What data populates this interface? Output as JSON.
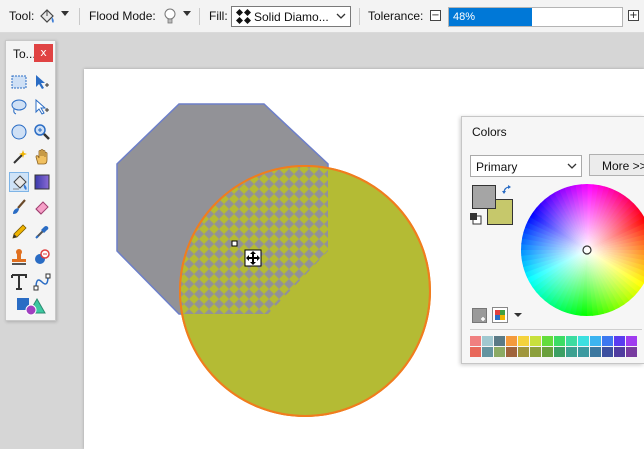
{
  "toolbar": {
    "tool_label": "Tool:",
    "flood_mode_label": "Flood Mode:",
    "fill_label": "Fill:",
    "fill_value": "Solid Diamo...",
    "tolerance_label": "Tolerance:",
    "tolerance_value": "48%",
    "tolerance_fraction": 0.48,
    "decrease_symbol": "−",
    "increase_symbol": "+"
  },
  "tools_panel": {
    "title": "To...",
    "close": "x",
    "tools": [
      "rectangle-select-icon",
      "move-selection-icon",
      "lasso-select-icon",
      "move-selected-icon",
      "ellipse-select-icon",
      "zoom-icon",
      "magic-wand-icon",
      "pan-icon",
      "paint-bucket-icon",
      "gradient-icon",
      "paintbrush-icon",
      "eraser-icon",
      "pencil-icon",
      "color-picker-icon",
      "clone-stamp-icon",
      "recolor-icon",
      "text-icon",
      "line-curve-icon",
      "shapes-icon"
    ],
    "active_tool": "paint-bucket-icon"
  },
  "colors_panel": {
    "title": "Colors",
    "mode": "Primary",
    "more_button": "More >>",
    "primary_color": "#a5a5a5",
    "secondary_color": "#c6c86b",
    "palette_row1": [
      "#f08080",
      "#a0c8d0",
      "#5a7a86",
      "#f49a3c",
      "#f4d23c",
      "#c8e03c",
      "#64dc3c",
      "#3cdc64",
      "#3cdca0",
      "#3ce0e0",
      "#3cb4f0",
      "#3c78f0",
      "#5a3cf0",
      "#a03cf0"
    ],
    "palette_row2": [
      "#e8685a",
      "#6494a0",
      "#8caa64",
      "#a0643c",
      "#a0963c",
      "#8ca03c",
      "#6aa03c",
      "#3ca064",
      "#3ca090",
      "#3c9aa0",
      "#3c78a0",
      "#3c50a0",
      "#503ca0",
      "#783ca0"
    ]
  },
  "canvas": {
    "octagon_color": "#929297",
    "octagon_stroke": "#6d7fc9",
    "circle_color": "#b4bb34",
    "circle_stroke": "#f07d1e"
  }
}
